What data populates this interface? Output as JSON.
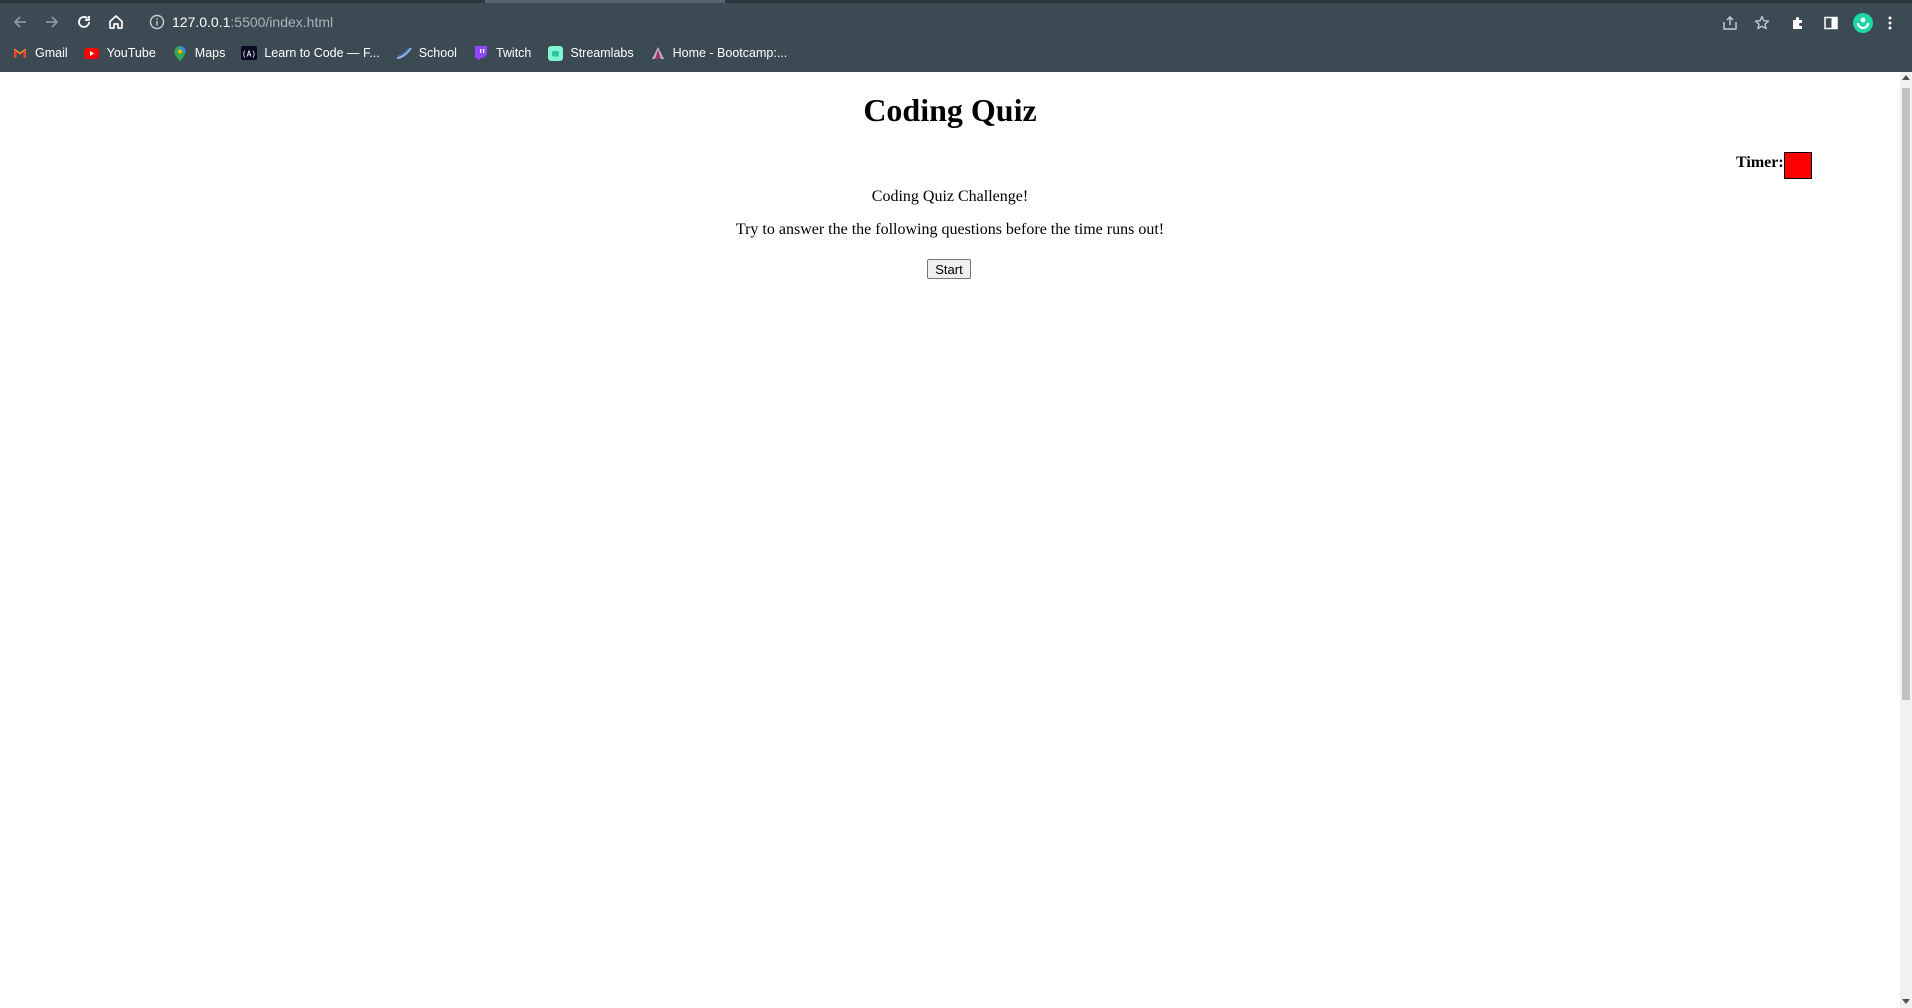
{
  "browser": {
    "url_host": "127.0.0.1",
    "url_path": ":5500/index.html",
    "bookmarks": [
      {
        "label": "Gmail",
        "icon": "gmail-icon"
      },
      {
        "label": "YouTube",
        "icon": "youtube-icon"
      },
      {
        "label": "Maps",
        "icon": "maps-icon"
      },
      {
        "label": "Learn to Code — F...",
        "icon": "freecodecamp-icon"
      },
      {
        "label": "School",
        "icon": "school-icon"
      },
      {
        "label": "Twitch",
        "icon": "twitch-icon"
      },
      {
        "label": "Streamlabs",
        "icon": "streamlabs-icon"
      },
      {
        "label": "Home - Bootcamp:...",
        "icon": "bootcamp-icon"
      }
    ]
  },
  "page": {
    "title": "Coding Quiz",
    "timer_label": "Timer:",
    "timer_value": "",
    "challenge_heading": "Coding Quiz Challenge!",
    "instructions": "Try to answer the the following questions before the time runs out!",
    "start_label": "Start"
  },
  "colors": {
    "chrome_bg": "#3c4a53",
    "timer_box": "#ff0000",
    "profile_avatar": "#1fd6a6"
  }
}
